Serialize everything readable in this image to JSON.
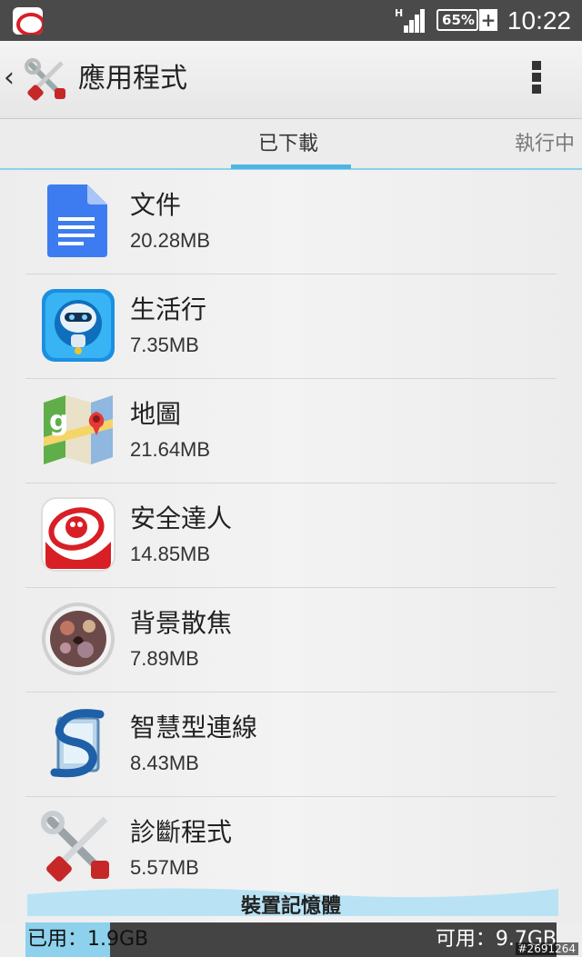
{
  "status_bar": {
    "network_type": "H",
    "battery_percent": "65%",
    "battery_charging": "+",
    "time": "10:22",
    "notification_icon": "security-app-notification-icon"
  },
  "action_bar": {
    "title": "應用程式",
    "back_icon": "chevron-left-icon",
    "logo_icon": "tools-icon",
    "menu_icon": "overflow-menu-icon"
  },
  "tabs": [
    {
      "label": "已下載",
      "selected": true
    },
    {
      "label": "執行中",
      "selected": false
    }
  ],
  "apps": [
    {
      "name": "文件",
      "size": "20.28MB",
      "icon": "google-docs-icon"
    },
    {
      "name": "生活行",
      "size": "7.35MB",
      "icon": "robot-icon"
    },
    {
      "name": "地圖",
      "size": "21.64MB",
      "icon": "google-maps-icon"
    },
    {
      "name": "安全達人",
      "size": "14.85MB",
      "icon": "security-app-icon"
    },
    {
      "name": "背景散焦",
      "size": "7.89MB",
      "icon": "background-defocus-icon"
    },
    {
      "name": "智慧型連線",
      "size": "8.43MB",
      "icon": "smart-connect-icon"
    },
    {
      "name": "診斷程式",
      "size": "5.57MB",
      "icon": "diagnostics-tools-icon"
    }
  ],
  "storage": {
    "label": "裝置記憶體",
    "used": "已用：1.9GB",
    "free": "可用：9.7GB",
    "used_fraction": 0.16
  },
  "watermark": "#2691264",
  "colors": {
    "accent": "#4fb5e0",
    "status_bar": "#4a4a4a",
    "used_bar": "#8dd1ec",
    "free_bar": "#444444"
  }
}
